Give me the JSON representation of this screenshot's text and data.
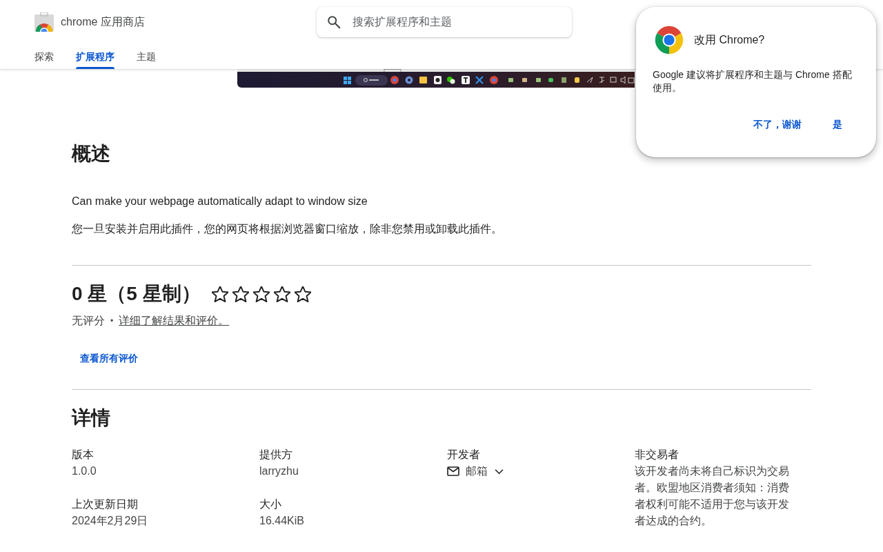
{
  "header": {
    "store_name": "chrome 应用商店",
    "search": {
      "placeholder": "搜索扩展程序和主题"
    },
    "tabs": [
      {
        "label": "探索",
        "selected": false
      },
      {
        "label": "扩展程序",
        "selected": true
      },
      {
        "label": "主题",
        "selected": false
      }
    ]
  },
  "overview": {
    "heading": "概述",
    "paragraphs": [
      "Can make your webpage automatically adapt to window size",
      "您一旦安装并启用此插件，您的网页将根据浏览器窗口缩放，除非您禁用或卸载此插件。"
    ]
  },
  "rating": {
    "heading": "0 星（5 星制）",
    "stars": 0,
    "summary": "无评分",
    "separator": "•",
    "link": "详细了解结果和评价。",
    "button": "查看所有评价"
  },
  "details": {
    "heading": "详情",
    "columns": [
      [
        {
          "kind": "text",
          "label": "版本",
          "value": "1.0.0"
        },
        {
          "kind": "text",
          "label": "上次更新日期",
          "value": "2024年2月29日"
        }
      ],
      [
        {
          "kind": "text",
          "label": "提供方",
          "value": "larryzhu"
        },
        {
          "kind": "text",
          "label": "大小",
          "value": "16.44KiB"
        }
      ],
      [
        {
          "kind": "email",
          "label": "开发者",
          "value": "邮箱"
        }
      ],
      [
        {
          "kind": "text",
          "label": "非交易者",
          "value": "该开发者尚未将自己标识为交易者。欧盟地区消费者须知：消费者权利可能不适用于您与该开发者达成的合约。"
        }
      ]
    ]
  },
  "popup": {
    "title": "改用 Chrome?",
    "message": "Google 建议将扩展程序和主题与 Chrome 搭配使用。",
    "buttons": [
      "不了，谢谢",
      "是"
    ]
  }
}
